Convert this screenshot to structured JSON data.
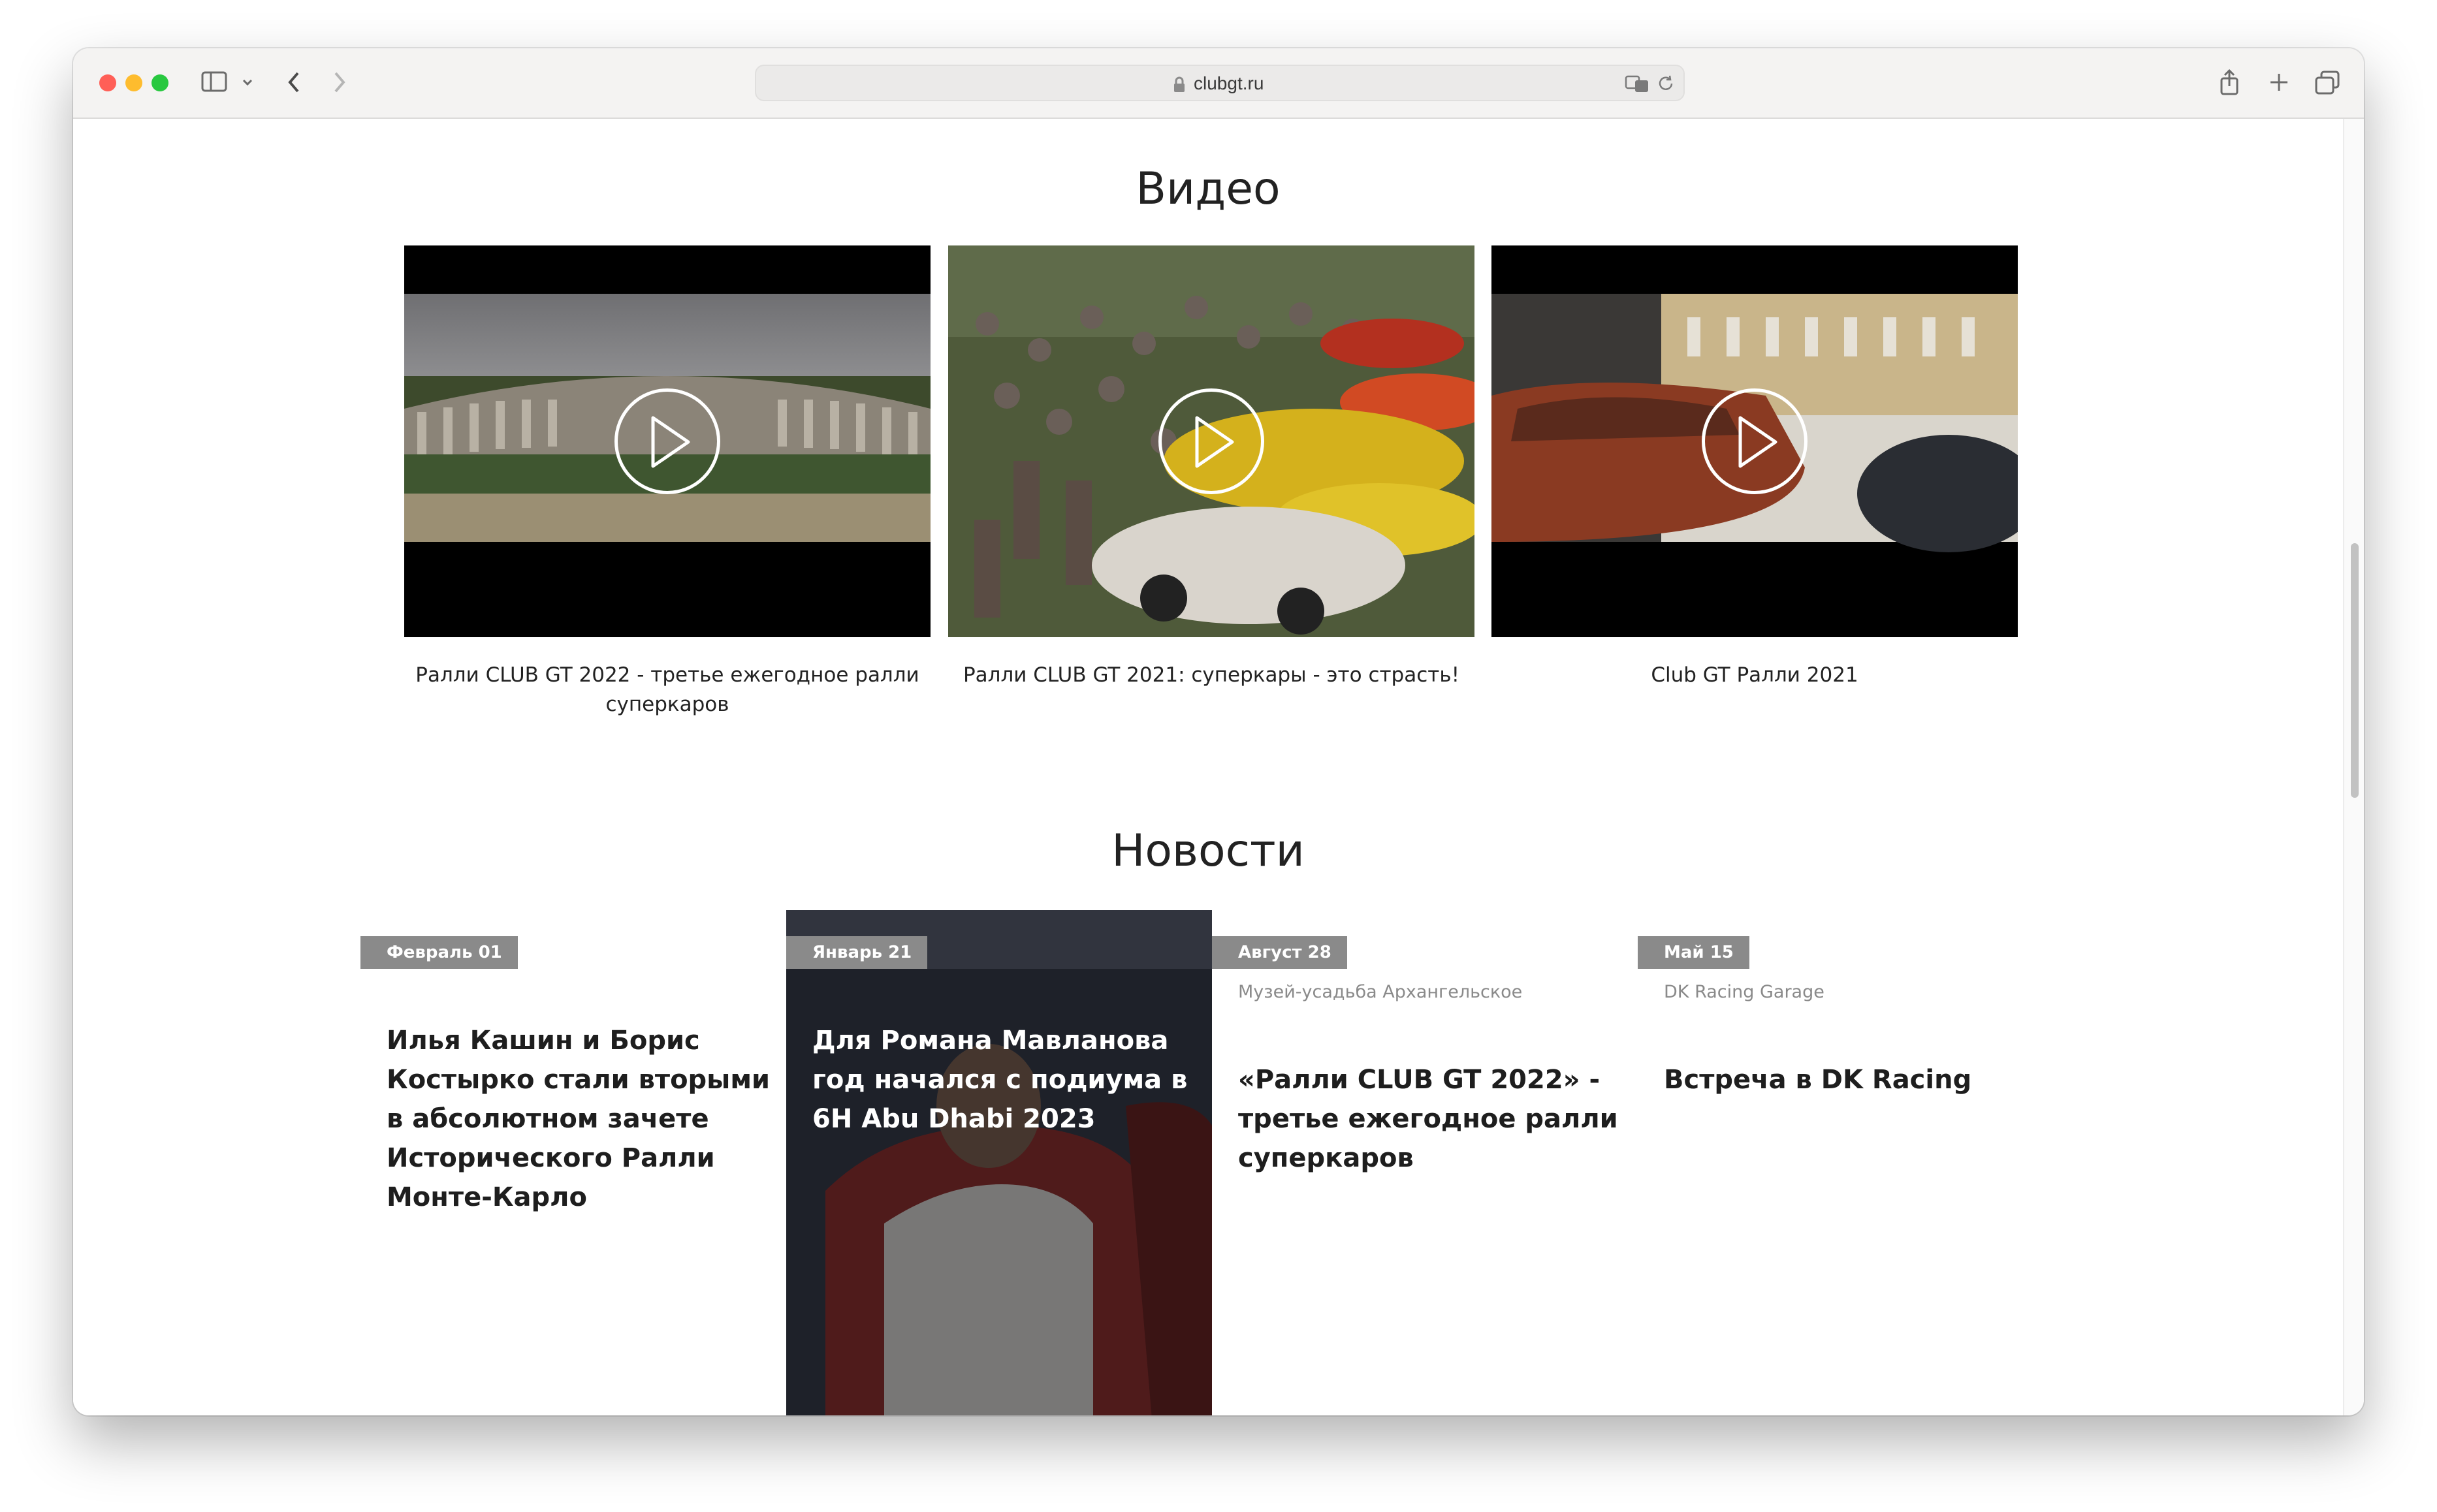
{
  "browser": {
    "url": "clubgt.ru"
  },
  "videos": {
    "title": "Видео",
    "items": [
      {
        "caption": "Ралли CLUB GT 2022 - третье ежегодное ралли суперкаров"
      },
      {
        "caption": "Ралли CLUB GT 2021: суперкары - это страсть!"
      },
      {
        "caption": "Club GT Ралли 2021"
      }
    ]
  },
  "news": {
    "title": "Новости",
    "items": [
      {
        "date": "Февраль 01",
        "category": "",
        "title": "Илья Кашин и Борис Костырко стали вторыми в абсолютном зачете Исторического Ралли Монте-Карло"
      },
      {
        "date": "Январь 21",
        "category": "",
        "title": "Для Романа Мавланова год начался с подиума в 6H Abu Dhabi 2023"
      },
      {
        "date": "Август 28",
        "category": "Музей-усадьба Архангельское",
        "title": "«Ралли CLUB GT 2022» - третье ежегодное ралли суперкаров"
      },
      {
        "date": "Май 15",
        "category": "DK Racing Garage",
        "title": "Встреча в DK Racing"
      }
    ]
  },
  "colors": {
    "badge": "#8a8a8a",
    "text": "#1e1e1e"
  }
}
